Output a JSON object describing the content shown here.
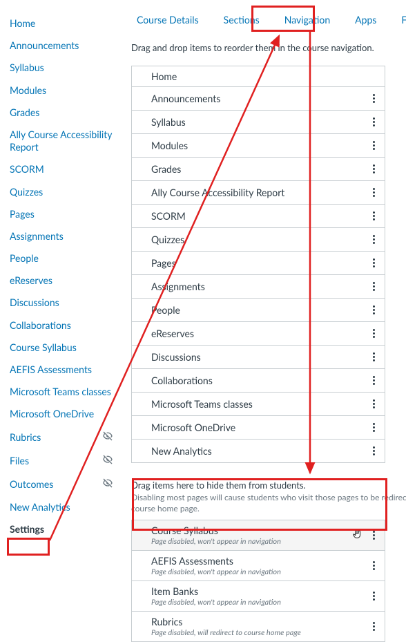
{
  "sidebar": {
    "items": [
      {
        "label": "Home",
        "hidden": false,
        "active": false
      },
      {
        "label": "Announcements",
        "hidden": false,
        "active": false
      },
      {
        "label": "Syllabus",
        "hidden": false,
        "active": false
      },
      {
        "label": "Modules",
        "hidden": false,
        "active": false
      },
      {
        "label": "Grades",
        "hidden": false,
        "active": false
      },
      {
        "label": "Ally Course Accessibility Report",
        "hidden": false,
        "active": false
      },
      {
        "label": "SCORM",
        "hidden": false,
        "active": false
      },
      {
        "label": "Quizzes",
        "hidden": false,
        "active": false
      },
      {
        "label": "Pages",
        "hidden": false,
        "active": false
      },
      {
        "label": "Assignments",
        "hidden": false,
        "active": false
      },
      {
        "label": "People",
        "hidden": false,
        "active": false
      },
      {
        "label": "eReserves",
        "hidden": false,
        "active": false
      },
      {
        "label": "Discussions",
        "hidden": false,
        "active": false
      },
      {
        "label": "Collaborations",
        "hidden": false,
        "active": false
      },
      {
        "label": "Course Syllabus",
        "hidden": false,
        "active": false
      },
      {
        "label": "AEFIS Assessments",
        "hidden": false,
        "active": false
      },
      {
        "label": "Microsoft Teams classes",
        "hidden": false,
        "active": false
      },
      {
        "label": "Microsoft OneDrive",
        "hidden": false,
        "active": false
      },
      {
        "label": "Rubrics",
        "hidden": true,
        "active": false
      },
      {
        "label": "Files",
        "hidden": true,
        "active": false
      },
      {
        "label": "Outcomes",
        "hidden": true,
        "active": false
      },
      {
        "label": "New Analytics",
        "hidden": false,
        "active": false
      },
      {
        "label": "Settings",
        "hidden": false,
        "active": true
      }
    ]
  },
  "tabs": [
    {
      "label": "Course Details"
    },
    {
      "label": "Sections"
    },
    {
      "label": "Navigation"
    },
    {
      "label": "Apps"
    },
    {
      "label": "Feature Op"
    }
  ],
  "instructions": {
    "reorder": "Drag and drop items to reorder them in the course navigation.",
    "hide_title": "Drag items here to hide them from students.",
    "hide_sub": "Disabling most pages will cause students who visit those pages to be redirected to the course home page."
  },
  "enabled_items": [
    {
      "title": "Home",
      "kebab": false
    },
    {
      "title": "Announcements",
      "kebab": true
    },
    {
      "title": "Syllabus",
      "kebab": true
    },
    {
      "title": "Modules",
      "kebab": true
    },
    {
      "title": "Grades",
      "kebab": true
    },
    {
      "title": "Ally Course Accessibility Report",
      "kebab": true
    },
    {
      "title": "SCORM",
      "kebab": true
    },
    {
      "title": "Quizzes",
      "kebab": true
    },
    {
      "title": "Pages",
      "kebab": true
    },
    {
      "title": "Assignments",
      "kebab": true
    },
    {
      "title": "People",
      "kebab": true
    },
    {
      "title": "eReserves",
      "kebab": true
    },
    {
      "title": "Discussions",
      "kebab": true
    },
    {
      "title": "Collaborations",
      "kebab": true
    },
    {
      "title": "Microsoft Teams classes",
      "kebab": true
    },
    {
      "title": "Microsoft OneDrive",
      "kebab": true
    },
    {
      "title": "New Analytics",
      "kebab": true
    }
  ],
  "disabled_items": [
    {
      "title": "Course Syllabus",
      "sub": "Page disabled, won't appear in navigation",
      "hovered": true
    },
    {
      "title": "AEFIS Assessments",
      "sub": "Page disabled, won't appear in navigation",
      "hovered": false
    },
    {
      "title": "Item Banks",
      "sub": "Page disabled, won't appear in navigation",
      "hovered": false
    },
    {
      "title": "Rubrics",
      "sub": "Page disabled, will redirect to course home page",
      "hovered": false
    }
  ]
}
